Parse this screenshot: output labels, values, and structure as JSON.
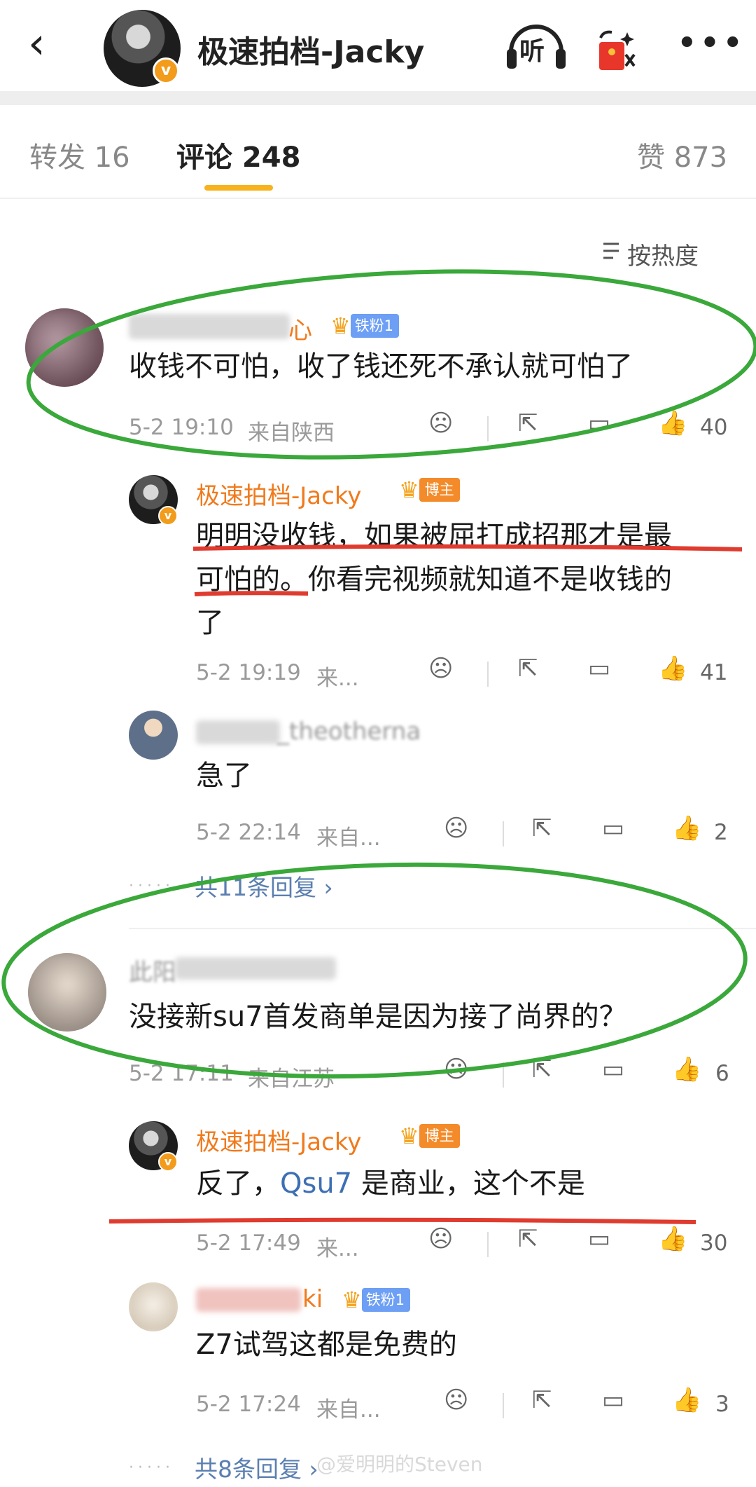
{
  "header": {
    "title": "极速拍档-Jacky",
    "listen_label": "听",
    "more_label": "•••"
  },
  "tabs": [
    {
      "label": "转发 16"
    },
    {
      "label": "评论 248"
    },
    {
      "label": "赞 873"
    }
  ],
  "sort_label": "按热度",
  "comments": [
    {
      "username_visible": "心",
      "badge": "铁粉1",
      "text": "收钱不可怕，收了钱还死不承认就可怕了",
      "time": "5-2 19:10",
      "location": "来自陕西",
      "likes": "40"
    },
    {
      "username": "极速拍档-Jacky",
      "badge": "博主",
      "text_line1": "明明没收钱，如果被屈打成招那才是最",
      "text_line2": "可怕的。你看完视频就知道不是收钱的",
      "text_line3": "了",
      "time": "5-2 19:19",
      "location": "来...",
      "likes": "41"
    },
    {
      "username_visible": "_theotherna",
      "text": "急了",
      "time": "5-2 22:14",
      "location": "来自...",
      "likes": "2"
    },
    {
      "replies_label": "共11条回复 ›"
    },
    {
      "username_visible": "此阳",
      "text": "没接新su7首发商单是因为接了尚界的？",
      "time": "5-2 17:11",
      "location": "来自江苏",
      "likes": "6"
    },
    {
      "username": "极速拍档-Jacky",
      "badge": "博主",
      "text_prefix": "反了，",
      "text_link": "Qsu7",
      "text_suffix": " 是商业，这个不是",
      "time": "5-2 17:49",
      "location": "来...",
      "likes": "30"
    },
    {
      "username_visible": "ki",
      "badge": "铁粉1",
      "text": "Z7试驾这都是免费的",
      "time": "5-2 17:24",
      "location": "来自...",
      "likes": "3"
    },
    {
      "replies_label": "共8条回复 ›"
    }
  ],
  "watermark": "@爱明明的Steven",
  "colors": {
    "accent": "#f8b21d",
    "username": "#f07a1c",
    "green_annotation": "#3aa83a",
    "red_annotation": "#e03b2f"
  }
}
